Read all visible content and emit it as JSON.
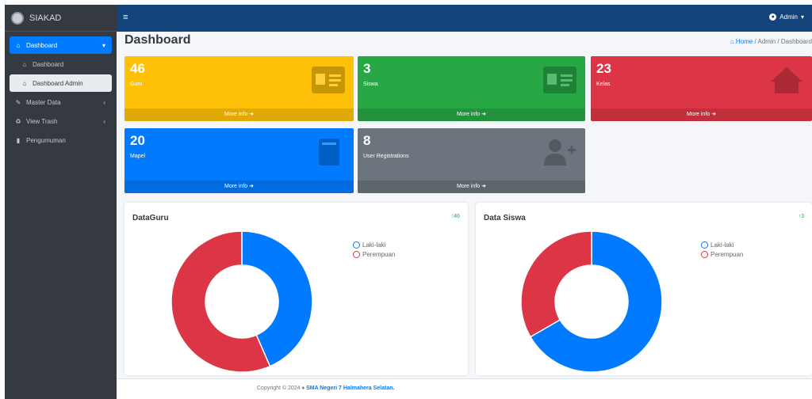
{
  "brand": {
    "name": "SIAKAD"
  },
  "topbar": {
    "menu_icon": "≡",
    "user_label": "Admin"
  },
  "sidebar": {
    "items": [
      {
        "label": "Dashboard",
        "icon": "⌂"
      },
      {
        "label": "Dashboard",
        "icon": "⌂"
      },
      {
        "label": "Dashboard Admin",
        "icon": "⌂"
      },
      {
        "label": "Master Data",
        "icon": "✎"
      },
      {
        "label": "View Trash",
        "icon": "♻"
      },
      {
        "label": "Pengumuman",
        "icon": "▮"
      }
    ]
  },
  "page": {
    "title": "Dashboard"
  },
  "breadcrumb": {
    "home": "Home",
    "admin": "Admin",
    "current": "Dashboard"
  },
  "boxes": {
    "guru": {
      "count": "46",
      "label": "Guru",
      "more": "More info"
    },
    "siswa": {
      "count": "3",
      "label": "Siswa",
      "more": "More info"
    },
    "kelas": {
      "count": "23",
      "label": "Kelas",
      "more": "More info"
    },
    "mapel": {
      "count": "20",
      "label": "Mapel",
      "more": "More info"
    },
    "user": {
      "count": "8",
      "label": "User Registrations",
      "more": "More info"
    }
  },
  "colors": {
    "guru": "#ffc107",
    "siswa": "#28a745",
    "kelas": "#dc3545",
    "mapel": "#007bff",
    "user": "#6c757d",
    "male": "#007bff",
    "female": "#dc3545"
  },
  "cards": {
    "guru": {
      "title": "DataGuru",
      "badge": "46"
    },
    "siswa": {
      "title": "Data Siswa",
      "badge": "3"
    }
  },
  "chart_data": [
    {
      "type": "pie",
      "title": "DataGuru",
      "categories": [
        "Laki-laki",
        "Perempuan"
      ],
      "values": [
        20,
        26
      ]
    },
    {
      "type": "pie",
      "title": "Data Siswa",
      "categories": [
        "Laki-laki",
        "Perempuan"
      ],
      "values": [
        2,
        1
      ]
    }
  ],
  "footer": {
    "prefix": "Copyright © 2024",
    "school": "SMA Negeri 7 Halmahera Selatan."
  }
}
